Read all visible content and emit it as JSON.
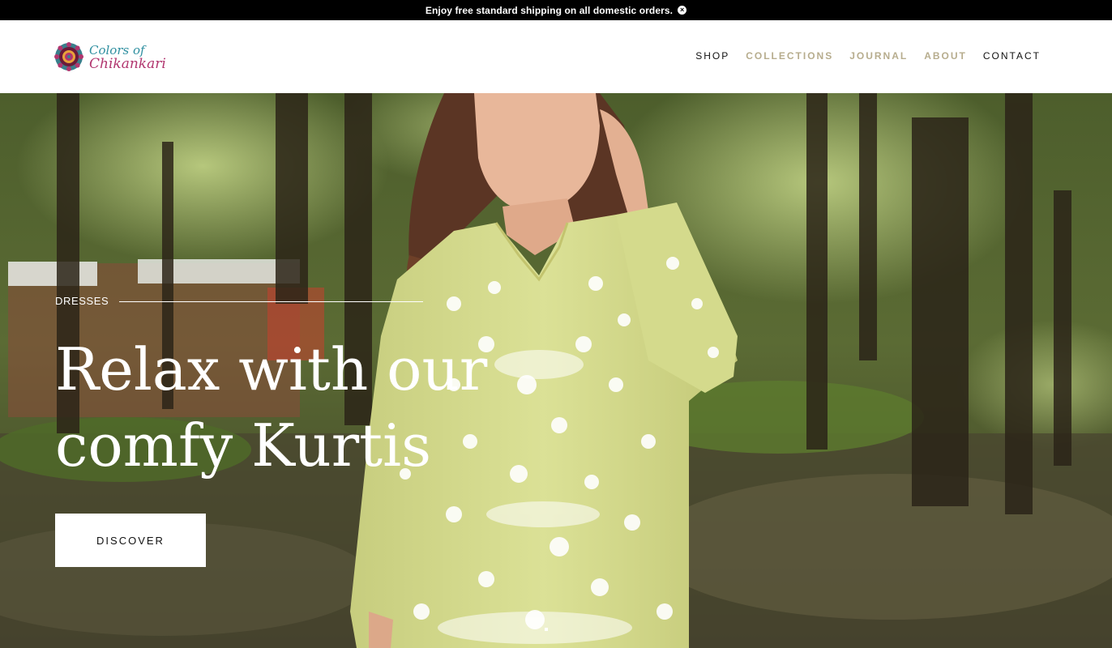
{
  "announcement": {
    "text": "Enjoy free standard shipping on all domestic orders.",
    "close_glyph": "×"
  },
  "brand": {
    "logo_line1": "Colors of",
    "logo_line2": "Chikankari",
    "colors": {
      "teal": "#2f8fa0",
      "magenta": "#b1356e",
      "mandala_dark": "#6b1a3a",
      "mandala_light": "#e8a23a"
    }
  },
  "nav": {
    "items": [
      {
        "label": "SHOP",
        "muted": false
      },
      {
        "label": "COLLECTIONS",
        "muted": true
      },
      {
        "label": "JOURNAL",
        "muted": true
      },
      {
        "label": "ABOUT",
        "muted": true
      },
      {
        "label": "CONTACT",
        "muted": false
      }
    ],
    "colors": {
      "active": "#111111",
      "muted": "#b7ad8e"
    }
  },
  "hero": {
    "eyebrow": "DRESSES",
    "headline_line1": "Relax with our",
    "headline_line2": "comfy Kurtis",
    "cta_label": "DISCOVER",
    "colors": {
      "foliage_dark": "#2e3a1e",
      "foliage_light": "#8ea64a",
      "kurta": "#d6dc8f",
      "embroidery": "#ffffff"
    }
  }
}
